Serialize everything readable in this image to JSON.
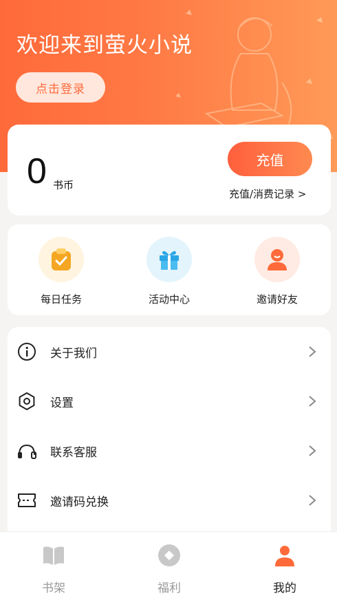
{
  "header": {
    "welcome_text": "欢迎来到萤火小说",
    "login_label": "点击登录"
  },
  "balance": {
    "amount": "0",
    "unit": "书币",
    "recharge_label": "充值",
    "record_link": "充值/消费记录 >"
  },
  "quick_actions": [
    {
      "label": "每日任务",
      "icon": "daily-task-icon",
      "color": "#f5a623"
    },
    {
      "label": "活动中心",
      "icon": "gift-icon",
      "color": "#2aa6e6"
    },
    {
      "label": "邀请好友",
      "icon": "invite-friend-icon",
      "color": "#ff6a3a"
    }
  ],
  "menu": [
    {
      "label": "关于我们",
      "icon": "info-icon"
    },
    {
      "label": "设置",
      "icon": "settings-icon"
    },
    {
      "label": "联系客服",
      "icon": "headset-icon"
    },
    {
      "label": "邀请码兑换",
      "icon": "ticket-icon"
    }
  ],
  "tabs": [
    {
      "label": "书架",
      "icon": "bookshelf-icon",
      "active": false
    },
    {
      "label": "福利",
      "icon": "welfare-icon",
      "active": false
    },
    {
      "label": "我的",
      "icon": "profile-icon",
      "active": true
    }
  ],
  "colors": {
    "accent": "#ff6a3a",
    "accent_light": "#ffe7dd",
    "active_tab": "#ff6a3a",
    "inactive_tab": "#c8c8c8"
  }
}
